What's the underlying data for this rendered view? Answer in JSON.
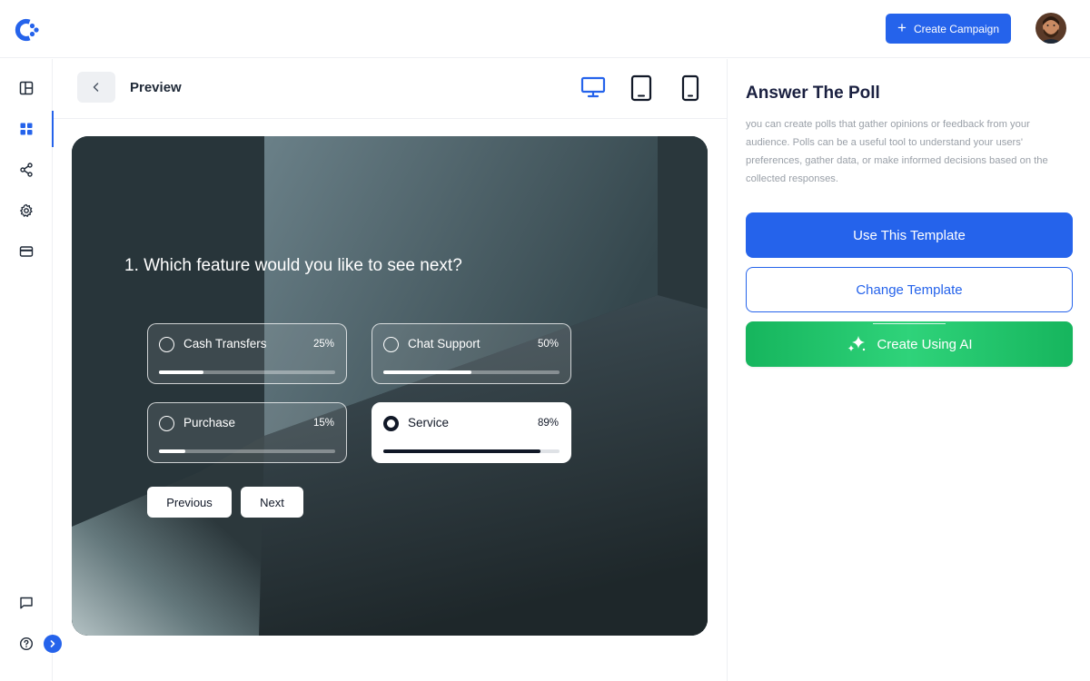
{
  "topbar": {
    "create_button_label": "Create Campaign",
    "accent_color": "#2563eb"
  },
  "sidebar": {
    "items": [
      {
        "name": "layout",
        "icon": "layout-icon"
      },
      {
        "name": "templates",
        "icon": "grid-icon",
        "active": true
      },
      {
        "name": "share",
        "icon": "share-icon"
      },
      {
        "name": "settings",
        "icon": "gear-icon"
      },
      {
        "name": "billing",
        "icon": "card-icon"
      },
      {
        "name": "messages",
        "icon": "chat-icon"
      },
      {
        "name": "help",
        "icon": "help-icon"
      }
    ]
  },
  "preview": {
    "title": "Preview",
    "devices": [
      "desktop-icon",
      "tablet-icon",
      "mobile-icon"
    ],
    "selected_device": "desktop"
  },
  "poll": {
    "question": "1. Which feature would you like to see next?",
    "options": [
      {
        "label": "Cash Transfers",
        "percent_label": "25%",
        "percent": 25,
        "selected": false
      },
      {
        "label": "Chat Support",
        "percent_label": "50%",
        "percent": 50,
        "selected": false
      },
      {
        "label": "Purchase",
        "percent_label": "15%",
        "percent": 15,
        "selected": false
      },
      {
        "label": "Service",
        "percent_label": "89%",
        "percent": 89,
        "selected": true
      }
    ],
    "previous_label": "Previous",
    "next_label": "Next"
  },
  "panel": {
    "title": "Answer The Poll",
    "description": "you can create polls that gather opinions or feedback from your audience. Polls can be a useful tool to understand your users' preferences, gather data, or make informed decisions based on the collected responses.",
    "use_template_label": "Use This Template",
    "change_template_label": "Change Template",
    "create_ai_label": "Create Using AI",
    "colors": {
      "primary": "#2563eb",
      "ai_green": "#22c46b"
    }
  }
}
